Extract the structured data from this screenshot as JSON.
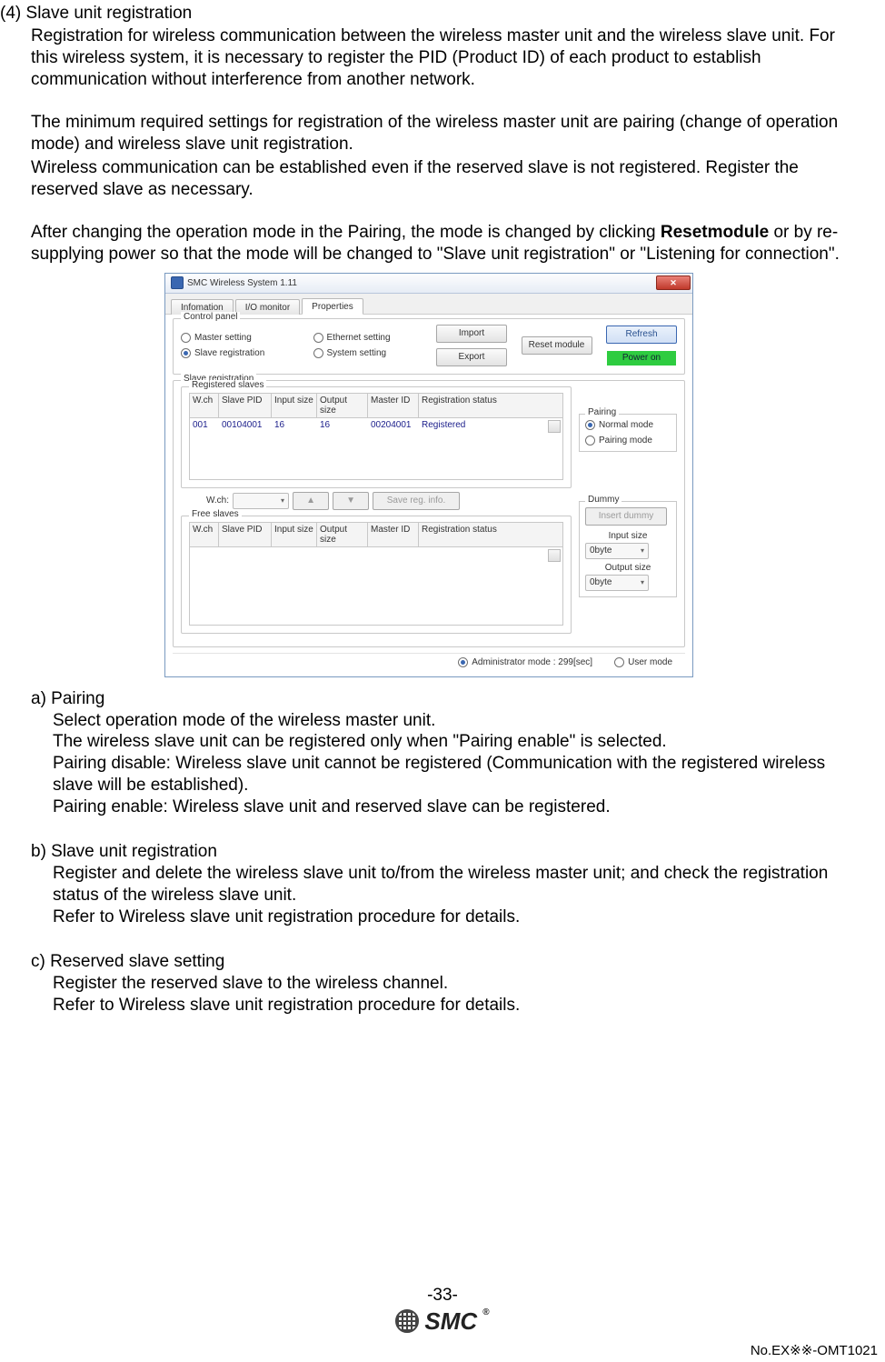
{
  "section": {
    "number": "(4)",
    "title": "Slave unit registration",
    "p1": "Registration for wireless communication between the wireless master unit and the wireless slave unit. For this wireless system, it is necessary to register the PID (Product ID) of each product to establish communication without interference from another network.",
    "p2": "The minimum required settings for registration of the wireless master unit are pairing (change of operation mode) and wireless slave unit registration.",
    "p3": "Wireless communication can be established even if the reserved slave is not registered. Register the reserved slave as necessary.",
    "p4a": "After changing the operation mode in the Pairing, the mode is changed by clicking ",
    "p4b_bold": "Resetmodule",
    "p4c": " or by re-supplying power so that the mode will be changed to \"Slave unit registration\" or \"Listening for connection\"."
  },
  "sub": {
    "a_title": "a) Pairing",
    "a1": "Select operation mode of the wireless master unit.",
    "a2": "The wireless slave unit can be registered only when \"Pairing enable\" is selected.",
    "a3": "Pairing disable: Wireless slave unit cannot be registered (Communication with the registered wireless slave will be established).",
    "a4": "Pairing enable: Wireless slave unit and reserved slave can be registered.",
    "b_title": "b) Slave unit registration",
    "b1": "Register and delete the wireless slave unit to/from the wireless master unit; and check the registration status of the wireless slave unit.",
    "b2": "Refer to Wireless slave unit registration procedure for details.",
    "c_title": "c) Reserved slave setting",
    "c1": "Register the reserved slave to the wireless channel.",
    "c2": "Refer to Wireless slave unit registration procedure for details."
  },
  "ui": {
    "window_title": "SMC Wireless System 1.11",
    "close_glyph": "✕",
    "tabs": {
      "info": "Infomation",
      "io": "I/O monitor",
      "prop": "Properties"
    },
    "cp": {
      "legend": "Control panel",
      "master": "Master setting",
      "slavereg": "Slave registration",
      "eth": "Ethernet setting",
      "sys": "System setting",
      "import": "Import",
      "export": "Export",
      "reset": "Reset module",
      "refresh": "Refresh",
      "power": "Power on"
    },
    "sr": {
      "legend": "Slave registration",
      "reg_legend": "Registered slaves",
      "free_legend": "Free slaves",
      "cols": {
        "wch": "W.ch",
        "pid": "Slave PID",
        "in": "Input size",
        "out": "Output size",
        "mid": "Master ID",
        "status": "Registration status"
      },
      "row": {
        "wch": "001",
        "pid": "00104001",
        "in": "16",
        "out": "16",
        "mid": "00204001",
        "status": "Registered"
      },
      "wch_label": "W.ch:",
      "up": "▲",
      "down": "▼",
      "save": "Save reg. info."
    },
    "pairing": {
      "legend": "Pairing",
      "normal": "Normal mode",
      "pairing": "Pairing mode"
    },
    "dummy": {
      "legend": "Dummy",
      "insert": "Insert dummy",
      "in_label": "Input size",
      "out_label": "Output size",
      "val": "0byte"
    },
    "footer": {
      "admin": "Administrator mode : 299[sec]",
      "user": "User mode"
    }
  },
  "page": {
    "number": "-33-",
    "logo_text": "SMC",
    "docno": "No.EX※※-OMT1021"
  }
}
